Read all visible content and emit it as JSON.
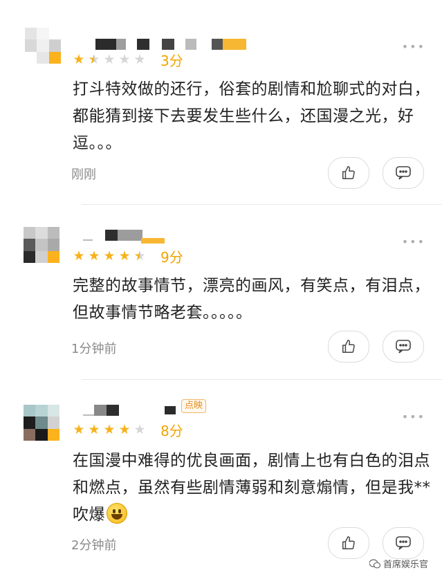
{
  "comments": [
    {
      "score": "3分",
      "stars": [
        "on",
        "half",
        "off",
        "off",
        "off"
      ],
      "text": "打斗特效做的还行，俗套的剧情和尬聊式的对白，都能猜到接下去要发生些什么，还国漫之光，好逗。。。",
      "time": "刚刚"
    },
    {
      "score": "9分",
      "stars": [
        "on",
        "on",
        "on",
        "on",
        "half"
      ],
      "text": "完整的故事情节，漂亮的画风，有笑点，有泪点，但故事情节略老套。。。。。",
      "time": "1分钟前"
    },
    {
      "score": "8分",
      "stars": [
        "on",
        "on",
        "on",
        "on",
        "off"
      ],
      "badge": "点映",
      "text": "在国漫中难得的优良画面，剧情上也有白色的泪点和燃点，虽然有些剧情薄弱和刻意煽情，但是我**吹爆",
      "emoji": "smile-emoji",
      "time": "2分钟前"
    }
  ],
  "more_label": "•••",
  "watermark": "首席娱乐官",
  "colors": {
    "star": "#f6b21b",
    "score": "#f0a500",
    "badge": "#e58b1e"
  },
  "icons": {
    "like": "thumbs-up-icon",
    "reply": "speech-bubble-icon",
    "more": "more-dots-icon"
  }
}
